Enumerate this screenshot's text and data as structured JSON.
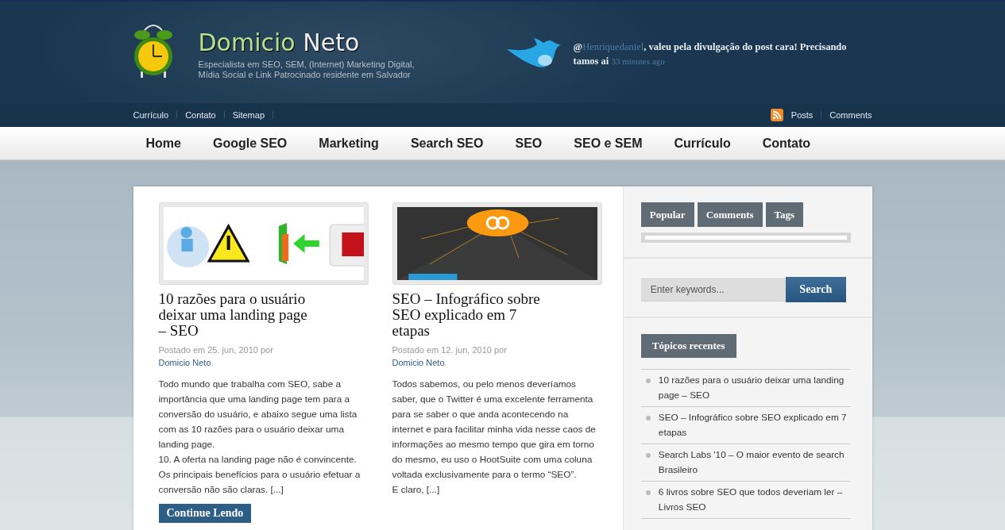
{
  "site": {
    "title_first": "Domicio",
    "title_second": "Neto",
    "tagline": "Especialista em SEO, SEM, (Internet) Marketing Digital, Mídia Social e Link Patrocinado residente em Salvador"
  },
  "tweet": {
    "prefix": "@",
    "mention": "Henriquedaniel",
    "text": ", valeu pela divulgação do post cara! Precisando tamos ai",
    "time": "33 minutes ago"
  },
  "top_links": [
    "Currículo",
    "Contato",
    "Sitemap"
  ],
  "feed_links": [
    "Posts",
    "Comments"
  ],
  "nav": [
    "Home",
    "Google SEO",
    "Marketing",
    "Search SEO",
    "SEO",
    "SEO e SEM",
    "Currículo",
    "Contato"
  ],
  "posts": [
    {
      "title": "10 razões para o usuário deixar uma landing page – SEO",
      "meta": "Postado em 25. jun, 2010 por",
      "author": "Domicio Neto",
      "meta_end": ".",
      "paragraphs": [
        "Todo mundo que trabalha com SEO, sabe a importância que uma landing page tem para a conversão do usuário, e abaixo segue uma lista com as 10 razões para o usuário deixar uma landing page.",
        "10. A oferta na landing page não é convincente. Os principais benefícios para o usuário efetuar a conversão não são claras. [...]"
      ],
      "button": "Continue Lendo",
      "image": {
        "kind": "picture"
      }
    },
    {
      "title": "SEO – Infográfico sobre SEO explicado em 7 etapas",
      "meta": "Postado em 12. jun, 2010 por",
      "author": "Domicio Neto",
      "meta_end": ".",
      "paragraphs": [
        "Todos sabemos, ou pelo menos deveríamos saber, que o Twitter é uma excelente ferramenta para se saber o que anda acontecendo na internet e para facilitar minha vida nesse caos de informações ao mesmo tempo que gira em torno do mesmo, eu uso o HootSuite com uma coluna voltada exclusivamente para o termo “SEO”.",
        "E claro, [...]"
      ],
      "image": {
        "kind": "picture"
      }
    }
  ],
  "sidebar": {
    "tabs": [
      "Popular",
      "Comments",
      "Tags"
    ],
    "search": {
      "placeholder": "Enter keywords...",
      "button": "Search"
    },
    "recent": {
      "heading": "Tópicos recentes",
      "items": [
        "10 razões para o usuário deixar uma landing page – SEO",
        "SEO – Infográfico sobre SEO explicado em 7 etapas",
        "Search Labs '10 – O maior evento de search Brasileiro",
        "6 livros sobre SEO que todos deveriam ler – Livros SEO"
      ]
    }
  }
}
